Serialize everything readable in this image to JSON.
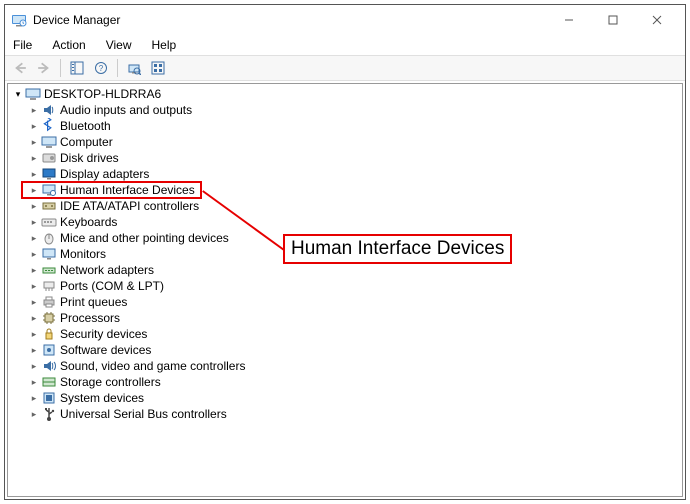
{
  "window": {
    "title": "Device Manager"
  },
  "menubar": [
    "File",
    "Action",
    "View",
    "Help"
  ],
  "root": {
    "label": "DESKTOP-HLDRRA6"
  },
  "categories": [
    {
      "label": "Audio inputs and outputs",
      "icon": "audio"
    },
    {
      "label": "Bluetooth",
      "icon": "bluetooth"
    },
    {
      "label": "Computer",
      "icon": "computer"
    },
    {
      "label": "Disk drives",
      "icon": "disk"
    },
    {
      "label": "Display adapters",
      "icon": "display"
    },
    {
      "label": "Human Interface Devices",
      "icon": "hid",
      "highlight": true
    },
    {
      "label": "IDE ATA/ATAPI controllers",
      "icon": "ide"
    },
    {
      "label": "Keyboards",
      "icon": "keyboard"
    },
    {
      "label": "Mice and other pointing devices",
      "icon": "mouse"
    },
    {
      "label": "Monitors",
      "icon": "monitor"
    },
    {
      "label": "Network adapters",
      "icon": "network"
    },
    {
      "label": "Ports (COM & LPT)",
      "icon": "port"
    },
    {
      "label": "Print queues",
      "icon": "printer"
    },
    {
      "label": "Processors",
      "icon": "cpu"
    },
    {
      "label": "Security devices",
      "icon": "security"
    },
    {
      "label": "Software devices",
      "icon": "software"
    },
    {
      "label": "Sound, video and game controllers",
      "icon": "sound"
    },
    {
      "label": "Storage controllers",
      "icon": "storage"
    },
    {
      "label": "System devices",
      "icon": "system"
    },
    {
      "label": "Universal Serial Bus controllers",
      "icon": "usb"
    }
  ],
  "callout": {
    "text": "Human Interface Devices"
  },
  "colors": {
    "highlight": "#e60000"
  }
}
